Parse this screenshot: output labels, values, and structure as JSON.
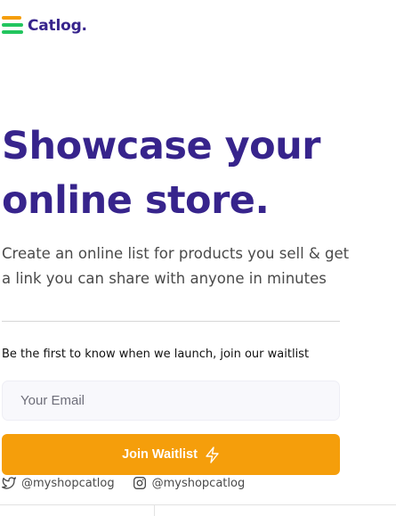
{
  "brand": {
    "name": "Catlog.",
    "colors": {
      "primary": "#37248c",
      "accent": "#f59e0b",
      "logo_bars": [
        "#f59e0b",
        "#22c55e",
        "#22c55e"
      ]
    }
  },
  "hero": {
    "title_line1": "Showcase your",
    "title_line2": "online store.",
    "subtitle_line1": "Create an online list for products you sell & get",
    "subtitle_line2": "a link you can share with anyone in minutes"
  },
  "waitlist": {
    "label": "Be the first to know when we launch, join our waitlist",
    "email_placeholder": "Your Email",
    "email_value": "",
    "button_label": "Join Waitlist",
    "button_icon": "lightning-bolt-icon"
  },
  "socials": [
    {
      "platform": "twitter",
      "icon": "twitter-icon",
      "handle": "@myshopcatlog"
    },
    {
      "platform": "instagram",
      "icon": "instagram-icon",
      "handle": "@myshopcatlog"
    }
  ]
}
